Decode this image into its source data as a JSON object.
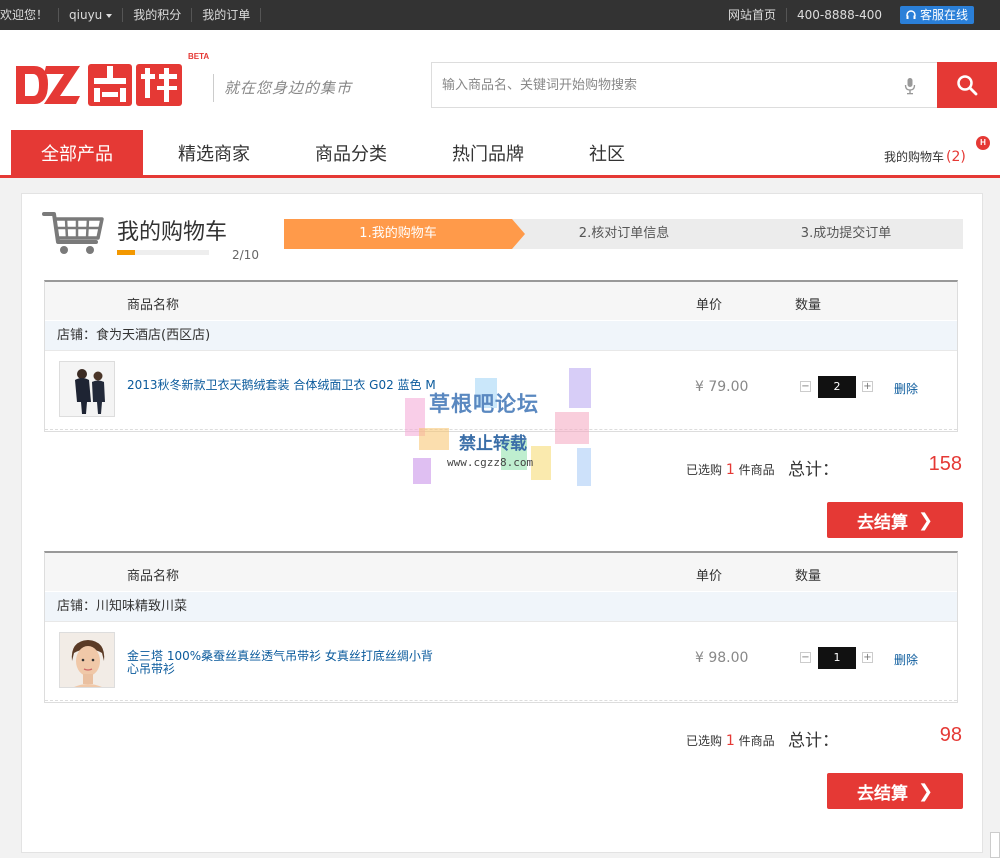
{
  "topbar": {
    "welcome": "欢迎您！",
    "username": "qiuyu",
    "points": "我的积分",
    "orders": "我的订单",
    "home": "网站首页",
    "phone": "400-8888-400",
    "service": "客服在线"
  },
  "header": {
    "logo_text": "DZ商城",
    "beta": "BETA",
    "slogan": "就在您身边的集市",
    "search_placeholder": "输入商品名、关键词开始购物搜索"
  },
  "nav": {
    "items": [
      "全部产品",
      "精选商家",
      "商品分类",
      "热门品牌",
      "社区"
    ],
    "cart_label": "我的购物车",
    "cart_count": "(2)",
    "badge": "H"
  },
  "cart": {
    "title": "我的购物车",
    "progress_text": "2/10",
    "progress_fraction": 0.2,
    "steps": [
      "1.我的购物车",
      "2.核对订单信息",
      "3.成功提交订单"
    ]
  },
  "table_headers": {
    "name": "商品名称",
    "price": "单价",
    "qty": "数量"
  },
  "stores": [
    {
      "store": "店铺：食为天酒店(西区店)",
      "item_name": "2013秋冬新款卫衣天鹅绒套装 合体绒面卫衣 G02 蓝色 M",
      "price": "¥ 79.00",
      "qty": "2",
      "delete": "删除",
      "sel_prefix": "已选购",
      "sel_count": "1",
      "sel_suffix": "件商品",
      "total_label": "总计：",
      "total": "158",
      "checkout": "去结算"
    },
    {
      "store": "店铺：川知味精致川菜",
      "item_name": "金三塔 100%桑蚕丝真丝透气吊带衫 女真丝打底丝绸小背心吊带衫",
      "price": "¥ 98.00",
      "qty": "1",
      "delete": "删除",
      "sel_prefix": "已选购",
      "sel_count": "1",
      "sel_suffix": "件商品",
      "total_label": "总计：",
      "total": "98",
      "checkout": "去结算"
    }
  ],
  "watermark": {
    "line1": "草根吧论坛",
    "line2": "禁止转载",
    "line3": "www.cgzz8.com"
  },
  "colors": {
    "brand": "#e53935",
    "step_active": "#ff9a4a",
    "link": "#0a5a9c"
  },
  "icons": [
    "caret-down-icon",
    "headset-icon",
    "microphone-icon",
    "search-icon",
    "shopping-cart-icon",
    "chevron-right-icon"
  ]
}
